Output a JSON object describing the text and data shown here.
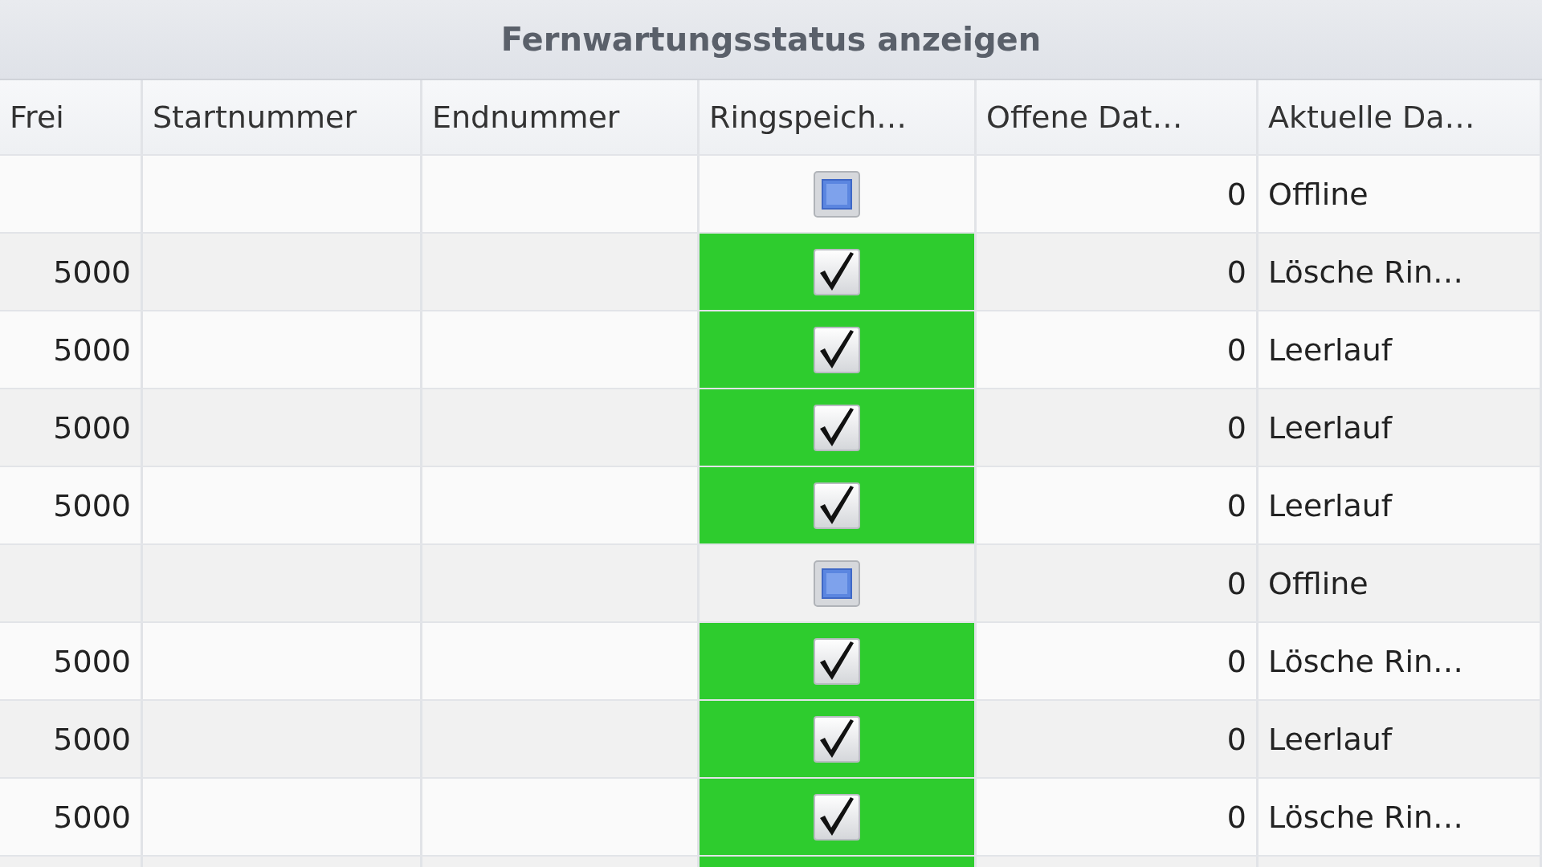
{
  "title": "Fernwartungsstatus anzeigen",
  "columns": [
    "Frei",
    "Startnummer",
    "Endnummer",
    "Ringspeich…",
    "Offene Dat…",
    "Aktuelle Da…"
  ],
  "rows": [
    {
      "frei": "",
      "kind": "offline",
      "offene": "0",
      "aktuell": "Offline"
    },
    {
      "frei": "5000",
      "kind": "checked",
      "offene": "0",
      "aktuell": "Lösche Rin…"
    },
    {
      "frei": "5000",
      "kind": "checked",
      "offene": "0",
      "aktuell": "Leerlauf"
    },
    {
      "frei": "5000",
      "kind": "checked",
      "offene": "0",
      "aktuell": "Leerlauf"
    },
    {
      "frei": "5000",
      "kind": "checked",
      "offene": "0",
      "aktuell": "Leerlauf"
    },
    {
      "frei": "",
      "kind": "offline",
      "offene": "0",
      "aktuell": "Offline"
    },
    {
      "frei": "5000",
      "kind": "checked",
      "offene": "0",
      "aktuell": "Lösche Rin…"
    },
    {
      "frei": "5000",
      "kind": "checked",
      "offene": "0",
      "aktuell": "Leerlauf"
    },
    {
      "frei": "5000",
      "kind": "checked",
      "offene": "0",
      "aktuell": "Lösche Rin…"
    },
    {
      "kind": "checked"
    }
  ]
}
